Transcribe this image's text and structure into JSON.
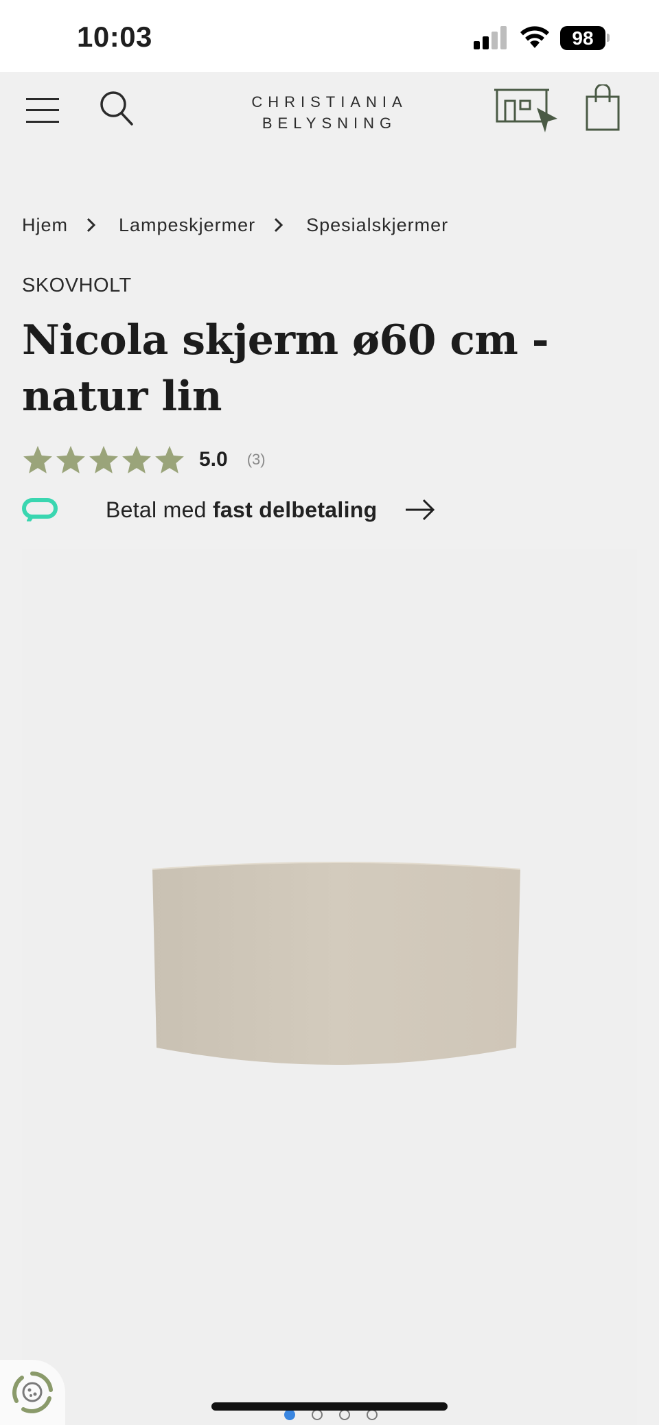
{
  "status_bar": {
    "time": "10:03",
    "battery": "98"
  },
  "header": {
    "logo_line1": "CHRISTIANIA",
    "logo_line2": "BELYSNING"
  },
  "breadcrumb": [
    "Hjem",
    "Lampeskjermer",
    "Spesialskjermer"
  ],
  "product": {
    "brand": "SKOVHOLT",
    "title": "Nicola skjerm ø60 cm - natur lin",
    "rating_value": "5.0",
    "rating_count": "(3)",
    "stars": 5
  },
  "installment": {
    "text_prefix": "Betal med ",
    "text_bold": "fast delbetaling"
  },
  "gallery": {
    "slide_count": 4,
    "active_index": 0
  },
  "colors": {
    "accent_green": "#4a5a45",
    "star_green": "#9aa47a",
    "installment_teal": "#3ad6b0",
    "shade_linen": "#cfc6b8"
  }
}
